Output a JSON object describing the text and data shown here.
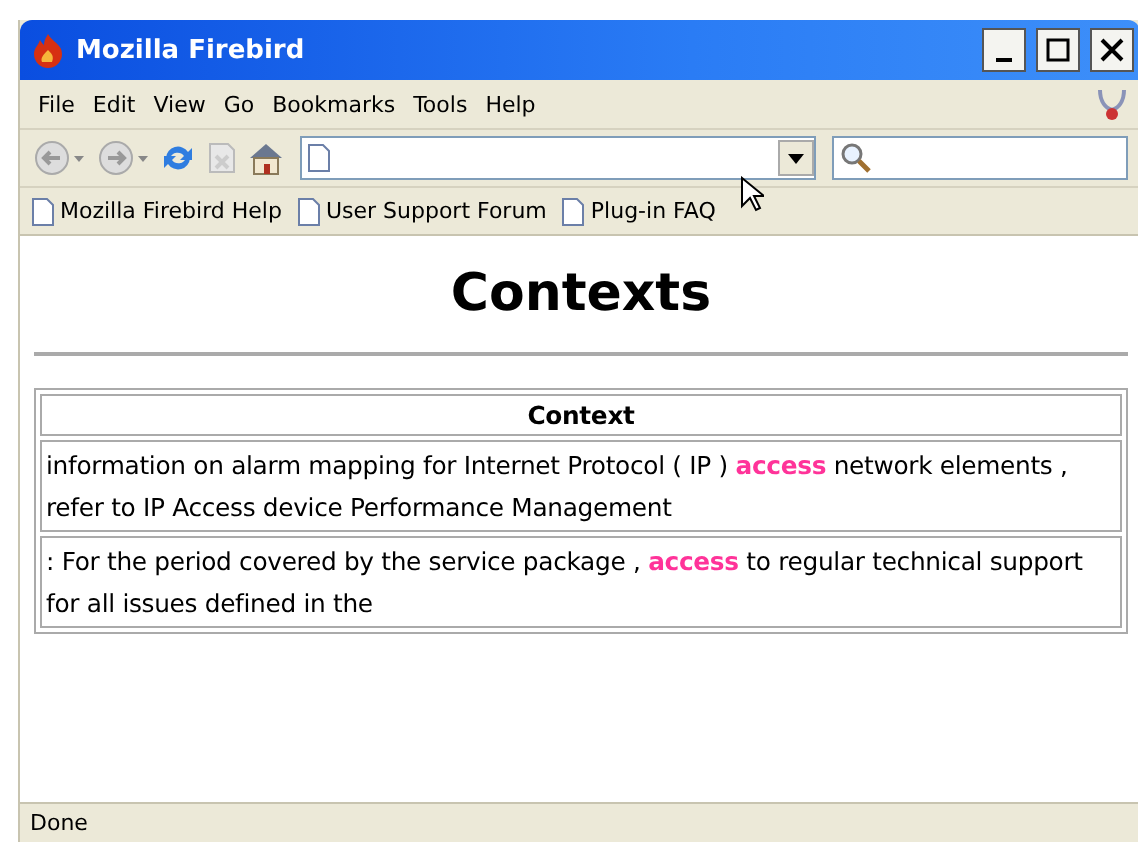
{
  "window": {
    "title": "Mozilla Firebird"
  },
  "menu": [
    "File",
    "Edit",
    "View",
    "Go",
    "Bookmarks",
    "Tools",
    "Help"
  ],
  "bookmarks": [
    "Mozilla Firebird Help",
    "User Support Forum",
    "Plug-in FAQ"
  ],
  "page": {
    "heading": "Contexts",
    "table": {
      "columns": [
        "Context"
      ],
      "rows": [
        "information on alarm mapping for Internet Protocol ( IP ) **access** network elements , refer to IP Access device Performance Management",
        ": For the period covered by the service package , **access** to regular technical support for all issues defined in the"
      ]
    }
  },
  "status_bar": "Done"
}
